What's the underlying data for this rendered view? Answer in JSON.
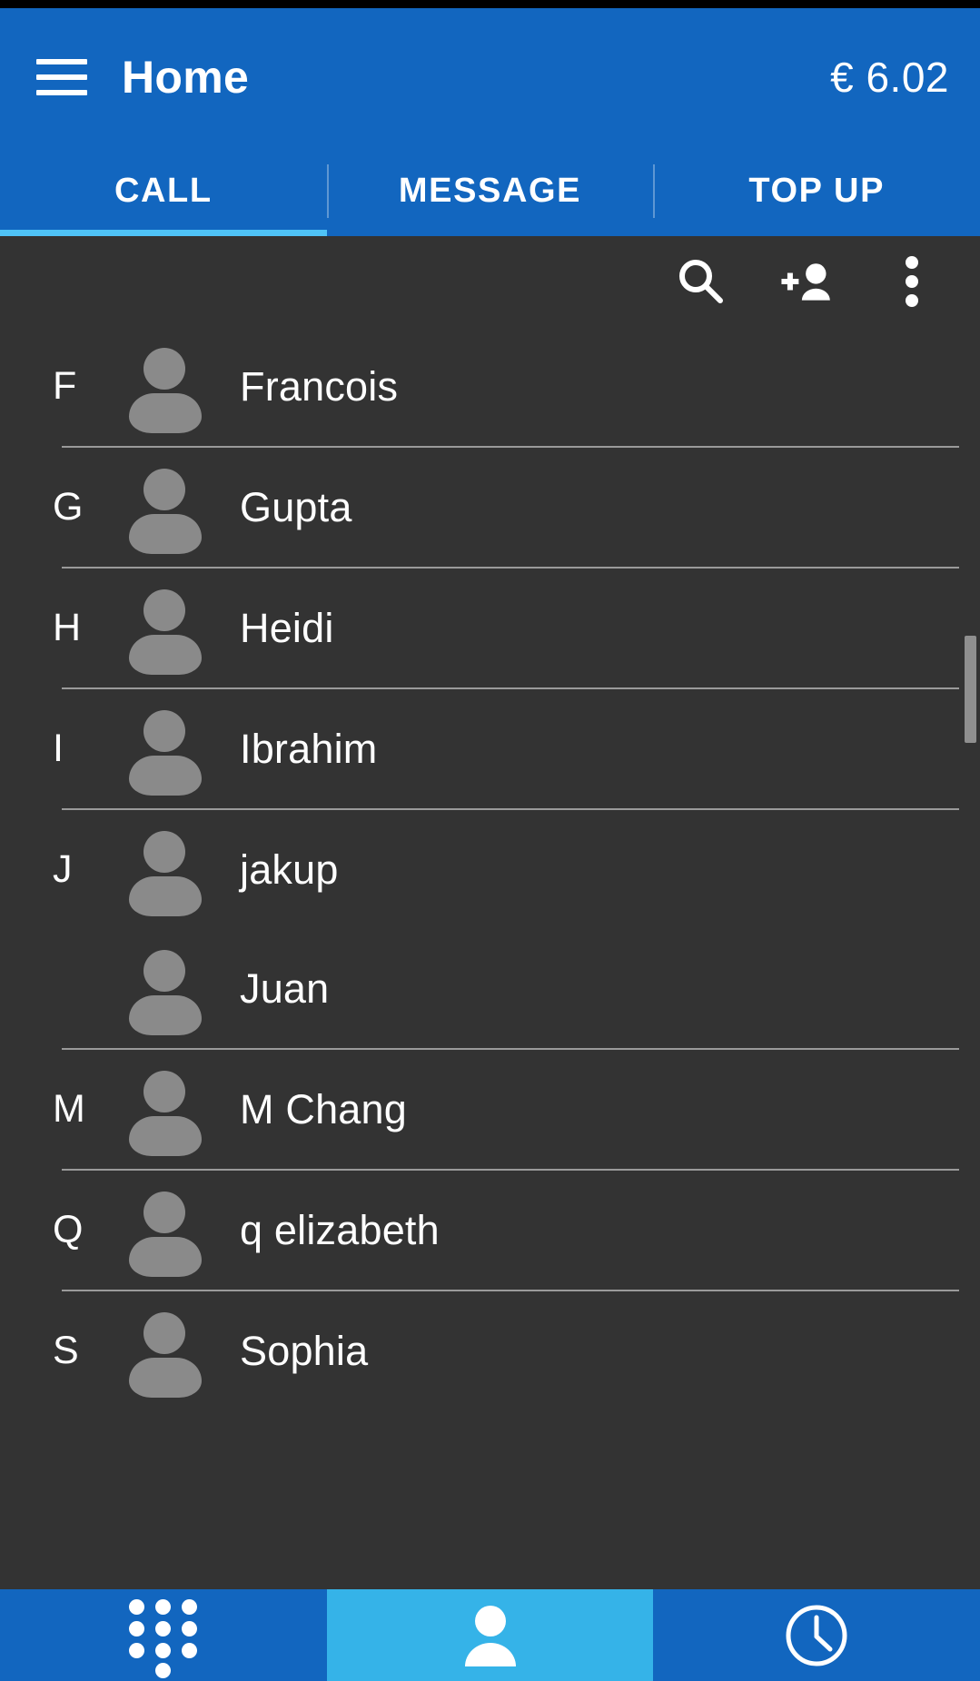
{
  "appbar": {
    "menu_icon": "hamburger-menu-icon",
    "title": "Home",
    "balance": "€ 6.02"
  },
  "tabs": {
    "items": [
      {
        "label": "CALL",
        "active": true
      },
      {
        "label": "MESSAGE",
        "active": false
      },
      {
        "label": "TOP UP",
        "active": false
      }
    ],
    "indicator_color": "#4fc3f7"
  },
  "toolbar": {
    "search_icon": "search-icon",
    "add_contact_icon": "add-person-icon",
    "overflow_icon": "more-vertical-icon"
  },
  "contacts": {
    "rows": [
      {
        "index_letter": "F",
        "name": "Francois",
        "divider": true
      },
      {
        "index_letter": "G",
        "name": "Gupta",
        "divider": true
      },
      {
        "index_letter": "H",
        "name": "Heidi",
        "divider": true
      },
      {
        "index_letter": "I",
        "name": "Ibrahim",
        "divider": true
      },
      {
        "index_letter": "J",
        "name": "jakup",
        "divider": false
      },
      {
        "index_letter": "",
        "name": "Juan",
        "divider": true
      },
      {
        "index_letter": "M",
        "name": "M Chang",
        "divider": true
      },
      {
        "index_letter": "Q",
        "name": "q elizabeth",
        "divider": true
      },
      {
        "index_letter": "S",
        "name": "Sophia",
        "divider": false
      }
    ]
  },
  "bottom_nav": {
    "items": [
      {
        "icon": "dialpad-icon",
        "active": false
      },
      {
        "icon": "person-icon",
        "active": true
      },
      {
        "icon": "clock-history-icon",
        "active": false
      }
    ]
  },
  "colors": {
    "app_bar_blue": "#1266bf",
    "accent_light_blue": "#4fc3f7",
    "nav_active_blue": "#35b3e8",
    "content_dark": "#333333",
    "avatar_gray": "#8a8a8a",
    "divider_gray": "#9a9a9a"
  }
}
